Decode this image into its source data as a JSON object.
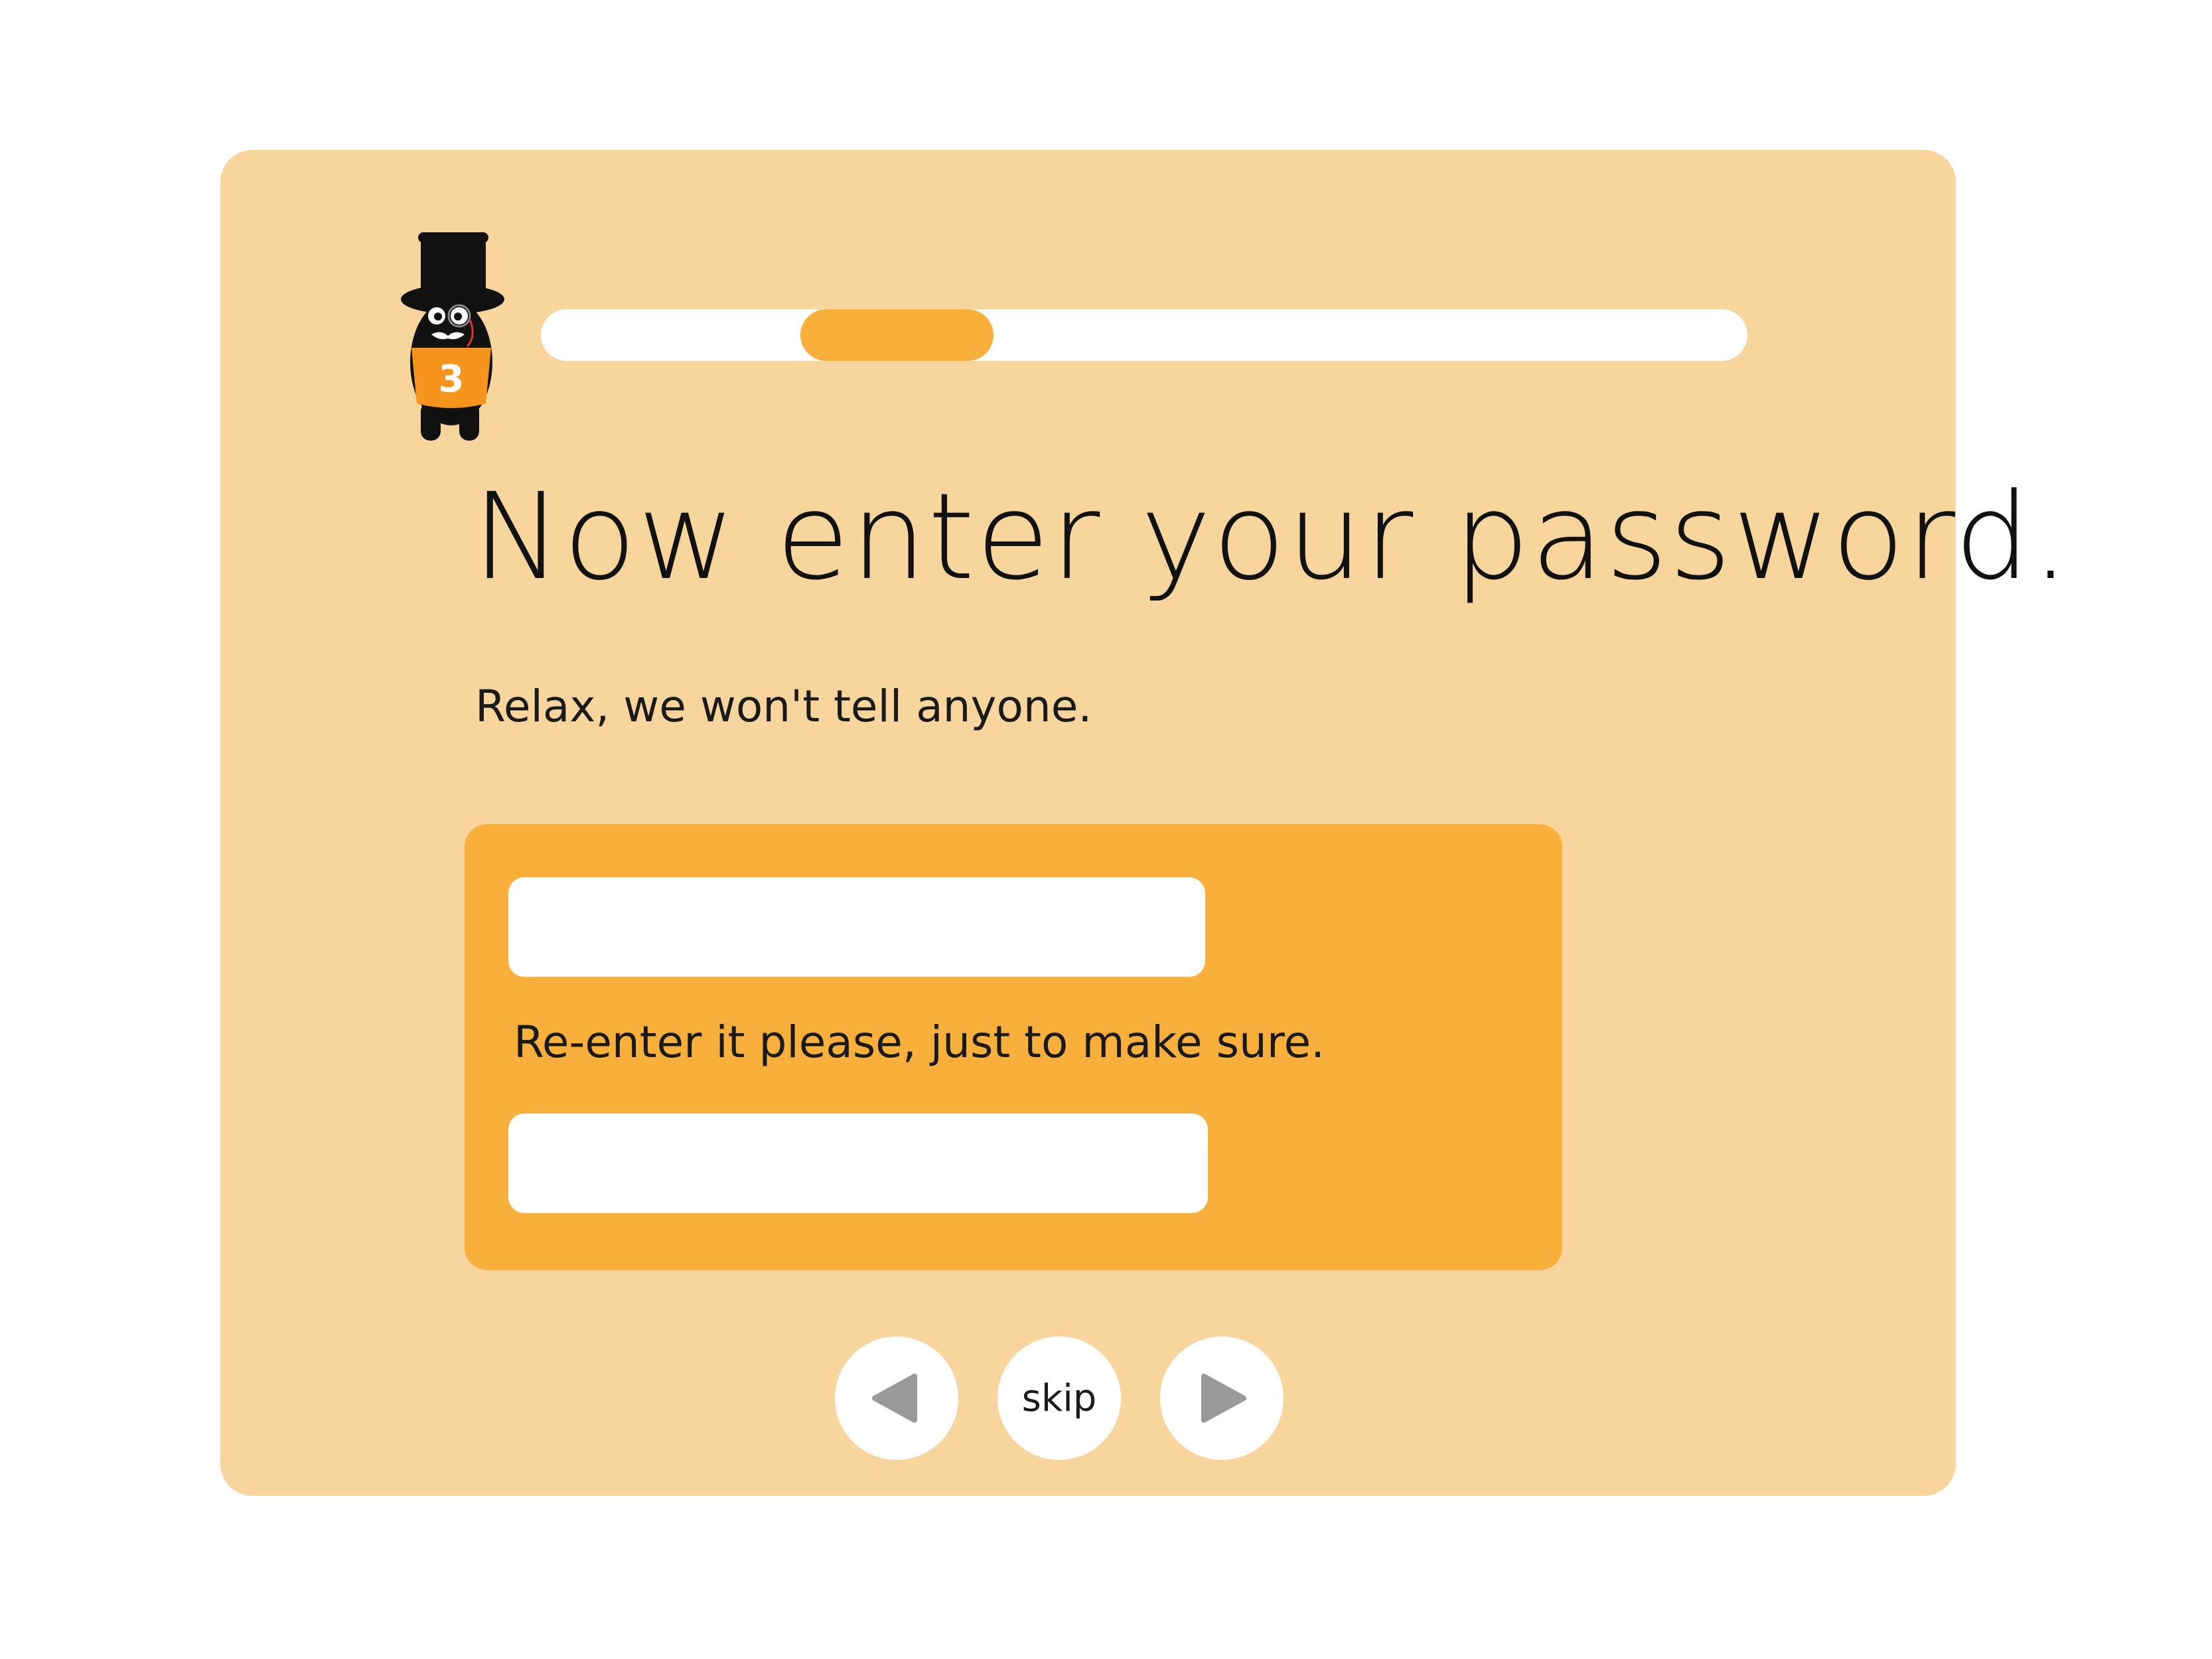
{
  "colors": {
    "page_background": "#ffffff",
    "card_background": "#f7d59c",
    "accent_orange": "#f9af3c",
    "white": "#ffffff",
    "arrow_gray": "#999999"
  },
  "progress": {
    "track_label": "",
    "thumb_position_fraction": 0.215,
    "thumb_width_fraction": 0.16
  },
  "heading": {
    "title": "Now enter your password.",
    "subtitle": "Relax, we won't tell anyone."
  },
  "form": {
    "password_value": "",
    "reenter_label": "Re-enter it please, just to make sure.",
    "confirm_value": ""
  },
  "nav": {
    "prev_icon": "triangle-left-icon",
    "skip_label": "skip",
    "next_icon": "triangle-right-icon"
  },
  "mascot": {
    "icon": "top-hat-creature-icon",
    "badge_text": "3"
  }
}
